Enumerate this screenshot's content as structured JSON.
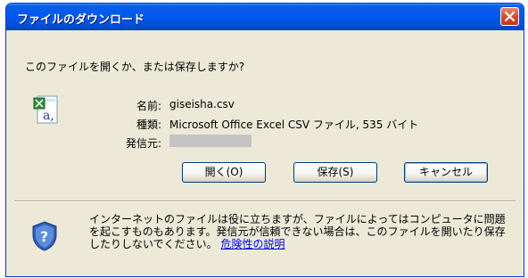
{
  "window": {
    "title": "ファイルのダウンロード"
  },
  "dialog": {
    "question": "このファイルを開くか、または保存しますか?",
    "file": {
      "name_label": "名前:",
      "name_value": "giseisha.csv",
      "type_label": "種類:",
      "type_value": "Microsoft Office Excel CSV ファイル, 535 バイト",
      "from_label": "発信元:"
    },
    "buttons": {
      "open": "開く(O)",
      "save": "保存(S)",
      "cancel": "キャンセル"
    },
    "warning": {
      "text": "インターネットのファイルは役に立ちますが、ファイルによってはコンピュータに問題を起こすものもあります。発信元が信頼できない場合は、このファイルを開いたり保存したりしないでください。",
      "link": "危険性の説明"
    }
  },
  "icons": {
    "file": "excel-csv-file-icon",
    "shield": "security-shield-icon",
    "close": "close-icon"
  },
  "colors": {
    "titlebar": "#0058ee",
    "close": "#d6472a",
    "dialog_bg": "#ece9d8",
    "link": "#0000ee"
  }
}
